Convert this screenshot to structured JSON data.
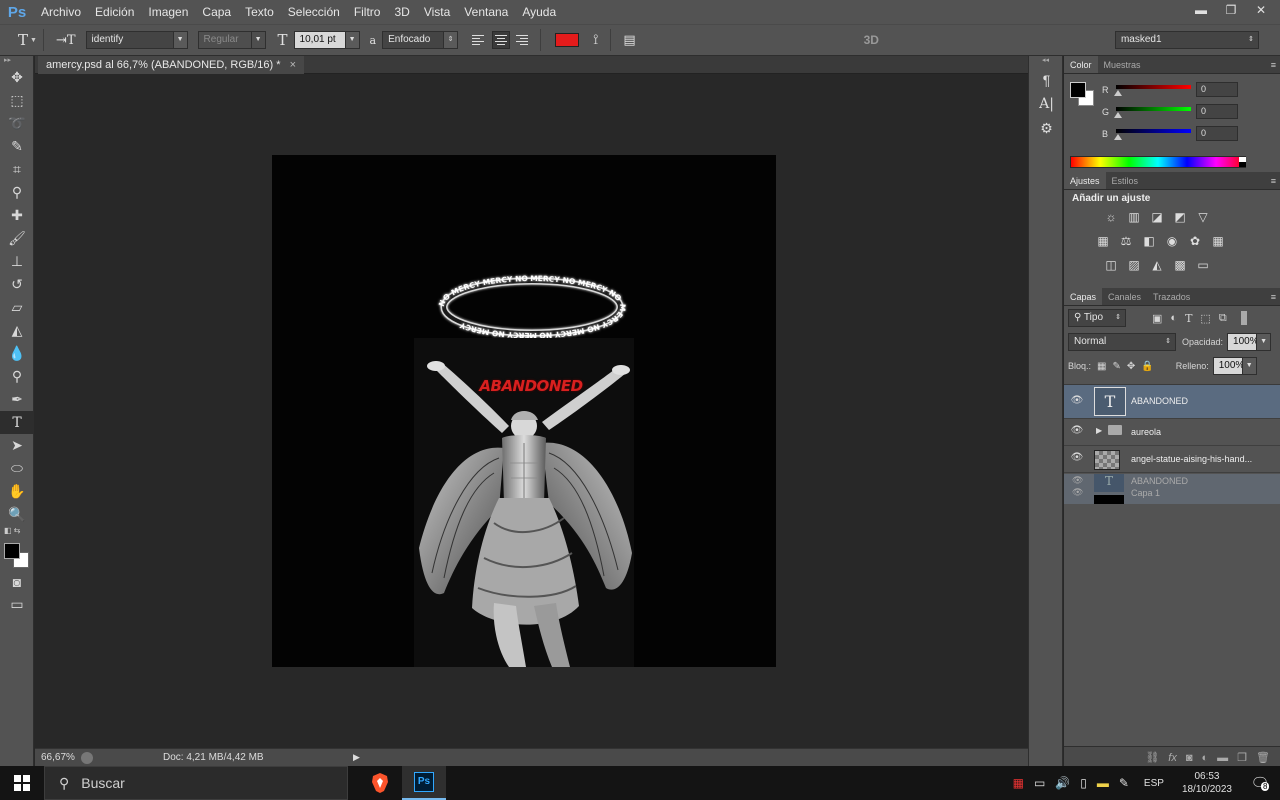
{
  "app": {
    "logo": "Ps",
    "menu": [
      "Archivo",
      "Edición",
      "Imagen",
      "Capa",
      "Texto",
      "Selección",
      "Filtro",
      "3D",
      "Vista",
      "Ventana",
      "Ayuda"
    ],
    "window_buttons": [
      "▬",
      "❐",
      "✕"
    ]
  },
  "options_bar": {
    "font_family": "identify",
    "font_style": "Regular",
    "font_size": "10,01 pt",
    "aa_label": "a",
    "antialias": "Enfocado",
    "text_color": "#e41b1b",
    "label_3d": "3D",
    "workspace": "masked1"
  },
  "document": {
    "tab_title": "amercy.psd al 66,7% (ABANDONED, RGB/16) *",
    "halo_text": "NO MERCY MERCY NO MERCY NO MERCY NO MERCY NO MERCY NO MERCY NO MERCY",
    "title_text": "ABANDONED"
  },
  "status_bar": {
    "zoom": "66,67%",
    "doc_info": "Doc: 4,21 MB/4,42 MB"
  },
  "color_panel": {
    "tabs": [
      "Color",
      "Muestras"
    ],
    "r_label": "R",
    "g_label": "G",
    "b_label": "B",
    "r": "0",
    "g": "0",
    "b": "0"
  },
  "adjustments_panel": {
    "tabs": [
      "Ajustes",
      "Estilos"
    ],
    "title": "Añadir un ajuste"
  },
  "layers_panel": {
    "tabs": [
      "Capas",
      "Canales",
      "Trazados"
    ],
    "filter": "Tipo",
    "blend_mode": "Normal",
    "opacity_label": "Opacidad:",
    "opacity": "100%",
    "lock_label": "Bloq.:",
    "fill_label": "Relleno:",
    "fill": "100%",
    "layers": [
      {
        "name": "ABANDONED",
        "kind": "text",
        "selected": true
      },
      {
        "name": "aureola",
        "kind": "group",
        "selected": false
      },
      {
        "name": "angel-statue-aising-his-hand...",
        "kind": "image",
        "selected": false
      }
    ],
    "drag_ghost": {
      "line1": "ABANDONED",
      "line2": "Capa 1"
    }
  },
  "taskbar": {
    "search_placeholder": "Buscar",
    "language": "ESP",
    "time": "06:53",
    "date": "18/10/2023",
    "notifications": "8"
  }
}
